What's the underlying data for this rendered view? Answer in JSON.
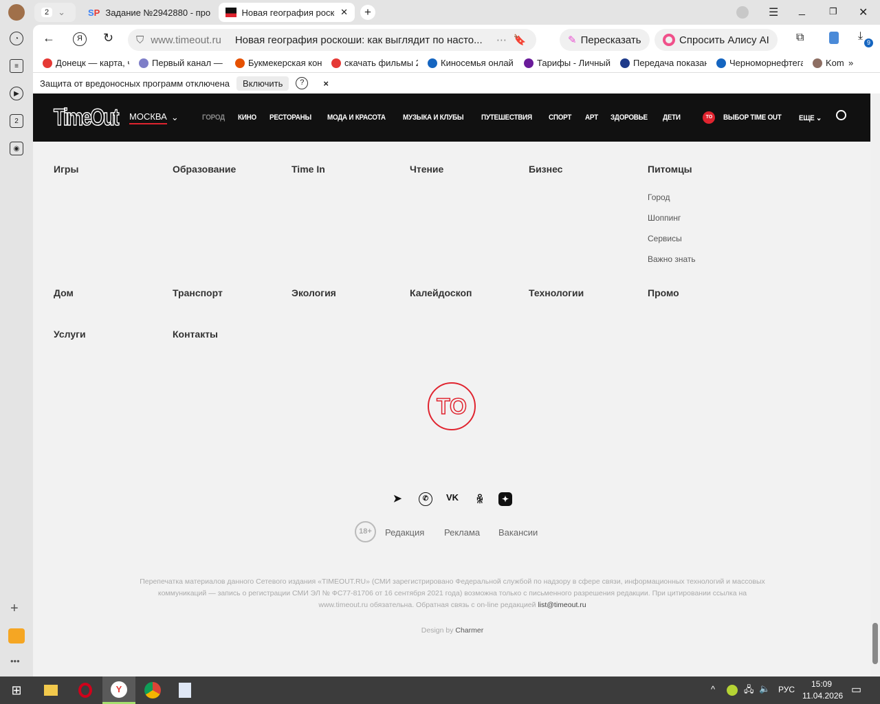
{
  "browser": {
    "tab_count": "2",
    "tabs": [
      {
        "label": "Задание №2942880 - про",
        "icon": "sp-icon"
      },
      {
        "label": "Новая география роскоши",
        "icon": "timeout-favicon"
      }
    ],
    "url": "www.timeout.ru",
    "page_title": "Новая география роскоши: как выглядит по насто...",
    "retell_label": "Пересказать",
    "alice_label": "Спросить Алису AI",
    "downloads_badge": "9",
    "sidebar_badge": "2",
    "bookmarks": [
      {
        "label": "Донецк — карта, ч",
        "color": "#e53935"
      },
      {
        "label": "Первый канал — с",
        "color": "#7e7ec8"
      },
      {
        "label": "Букмекерская кон",
        "color": "#e65100"
      },
      {
        "label": "скачать фильмы 2",
        "color": "#e53935"
      },
      {
        "label": "Киносемья онлай",
        "color": "#1565c0"
      },
      {
        "label": "Тарифы - Личный",
        "color": "#6a1b9a"
      },
      {
        "label": "Передача показан",
        "color": "#1e3a8a"
      },
      {
        "label": "Черноморнефтега",
        "color": "#1565c0"
      },
      {
        "label": "Komu",
        "color": "#8d6e63"
      }
    ],
    "infobar": {
      "text": "Защита от вредоносных программ отключена",
      "enable_label": "Включить"
    }
  },
  "site": {
    "city": "МОСКВА",
    "nav": [
      "ГОРОД",
      "КИНО",
      "РЕСТОРАНЫ",
      "МОДА И КРАСОТА",
      "МУЗЫКА И КЛУБЫ",
      "ПУТЕШЕСТВИЯ",
      "СПОРТ",
      "АРТ",
      "ЗДОРОВЬЕ",
      "ДЕТИ"
    ],
    "to_badge": "TO",
    "choice": "ВЫБОР TIME OUT",
    "more": "ЕЩЕ",
    "accent": "#e0242f",
    "menu_row1": [
      "Игры",
      "Образование",
      "Time In",
      "Чтение",
      "Бизнес",
      "Питомцы"
    ],
    "pets_sub": [
      "Город",
      "Шоппинг",
      "Сервисы",
      "Важно знать"
    ],
    "menu_row2": [
      "Дом",
      "Транспорт",
      "Экология",
      "Калейдоскоп",
      "Технологии",
      "Промо"
    ],
    "menu_row3": [
      "Услуги",
      "Контакты"
    ],
    "age": "18+",
    "footer_links": [
      "Редакция",
      "Реклама",
      "Вакансии"
    ],
    "legal": "Перепечатка материалов данного Сетевого издания «TIMEOUT.RU» (СМИ зарегистрировано Федеральной службой по надзору в сфере связи, информационных технологий и массовых коммуникаций — запись о регистрации СМИ ЭЛ № ФС77-81706 от 16 сентября 2021 года) возможна только с письменного разрешения редакции. При цитировании ссылка на www.timeout.ru обязательна. Обратная связь с on-line редакцией ",
    "email": "list@timeout.ru",
    "design_by": "Design by ",
    "designer": "Charmer"
  },
  "taskbar": {
    "lang": "РУС",
    "time": "15:09",
    "date": "11.04.2026"
  }
}
